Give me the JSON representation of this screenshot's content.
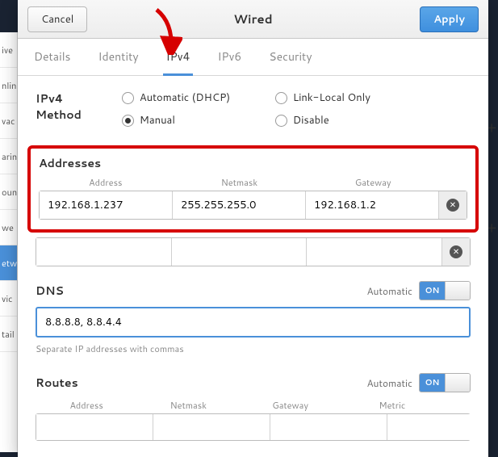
{
  "header": {
    "title": "Wired",
    "cancel": "Cancel",
    "apply": "Apply"
  },
  "tabs": [
    "Details",
    "Identity",
    "IPv4",
    "IPv6",
    "Security"
  ],
  "active_tab": 2,
  "method": {
    "label": "IPv4 Method",
    "options": [
      "Automatic (DHCP)",
      "Link-Local Only",
      "Manual",
      "Disable"
    ],
    "selected": 2
  },
  "addresses": {
    "title": "Addresses",
    "columns": [
      "Address",
      "Netmask",
      "Gateway"
    ],
    "rows": [
      {
        "address": "192.168.1.237",
        "netmask": "255.255.255.0",
        "gateway": "192.168.1.2"
      },
      {
        "address": "",
        "netmask": "",
        "gateway": ""
      }
    ]
  },
  "dns": {
    "title": "DNS",
    "automatic_label": "Automatic",
    "switch_on": "ON",
    "value": "8.8.8.8, 8.8.4.4",
    "hint": "Separate IP addresses with commas"
  },
  "routes": {
    "title": "Routes",
    "automatic_label": "Automatic",
    "switch_on": "ON",
    "columns": [
      "Address",
      "Netmask",
      "Gateway",
      "Metric"
    ]
  },
  "sidebar": [
    "ive",
    "nlin",
    "vac",
    "arin",
    "oun",
    "we",
    "etw",
    "vic",
    "tail"
  ],
  "colors": {
    "accent": "#4a90d9",
    "highlight": "#d60000"
  }
}
